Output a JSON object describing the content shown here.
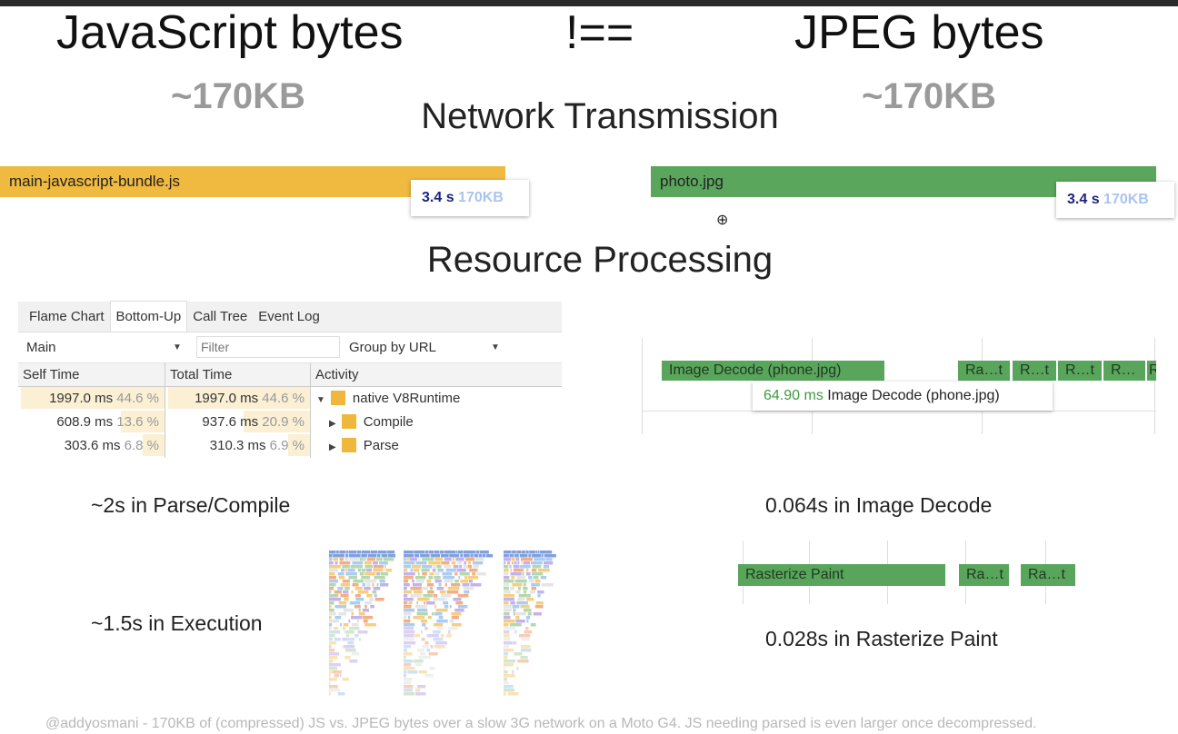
{
  "slide": {
    "left_title": "JavaScript bytes",
    "operator": "!==",
    "right_title": "JPEG bytes",
    "left_size": "~170KB",
    "right_size": "~170KB",
    "section1": "Network Transmission",
    "section2": "Resource Processing",
    "footer": "@addyosmani - 170KB of (compressed) JS vs. JPEG bytes over a slow 3G network on a Moto G4. JS needing parsed is even larger once decompressed."
  },
  "network": {
    "js": {
      "label": "main-javascript-bundle.js",
      "time": "3.4 s",
      "size": "170KB",
      "color": "#f0b940"
    },
    "jpg": {
      "label": "photo.jpg",
      "time": "3.4 s",
      "size": "170KB",
      "color": "#5aa65c"
    }
  },
  "devtools": {
    "tabs": [
      "Flame Chart",
      "Bottom-Up",
      "Call Tree",
      "Event Log"
    ],
    "active_tab": "Bottom-Up",
    "thread": "Main",
    "filter_placeholder": "Filter",
    "group": "Group by URL",
    "columns": [
      "Self Time",
      "Total Time",
      "Activity"
    ],
    "rows": [
      {
        "self": "1997.0 ms",
        "self_pct": "44.6 %",
        "total": "1997.0 ms",
        "total_pct": "44.6 %",
        "activity": "native V8Runtime",
        "expanded": true
      },
      {
        "self": "608.9 ms",
        "self_pct": "13.6 %",
        "total": "937.6 ms",
        "total_pct": "20.9 %",
        "activity": "Compile",
        "expanded": false
      },
      {
        "self": "303.6 ms",
        "self_pct": "6.8 %",
        "total": "310.3 ms",
        "total_pct": "6.9 %",
        "activity": "Parse",
        "expanded": false
      }
    ]
  },
  "decode": {
    "bar": "Image Decode (phone.jpg)",
    "small": [
      "Ra…t",
      "R…t",
      "R…t",
      "R…",
      "R"
    ],
    "tooltip_time": "64.90 ms",
    "tooltip_label": "Image Decode (phone.jpg)"
  },
  "raster": {
    "bar": "Rasterize Paint",
    "small": [
      "Ra…t",
      "Ra…t"
    ]
  },
  "captions": {
    "parse": "~2s in Parse/Compile",
    "exec": "~1.5s in Execution",
    "decode": "0.064s in Image Decode",
    "raster": "0.028s in Rasterize Paint"
  }
}
